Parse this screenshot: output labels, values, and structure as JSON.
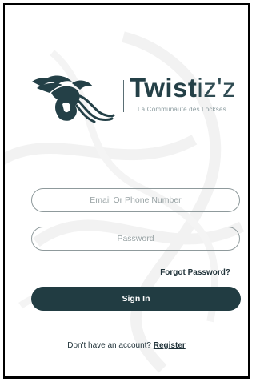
{
  "brand": {
    "name_bold": "Twist",
    "name_light": "iz'z",
    "tagline": "La Communaute des Lockses"
  },
  "form": {
    "email_placeholder": "Email Or Phone Number",
    "password_placeholder": "Password",
    "forgot_label": "Forgot Password?",
    "signin_label": "Sign In"
  },
  "footer": {
    "prompt": "Don't have an account?",
    "register_label": "Register"
  },
  "colors": {
    "accent": "#213c42",
    "brand_text": "#244047",
    "field_border": "#8f9a9c",
    "placeholder": "#9aa4a6"
  },
  "icons": [
    "logo-mark-icon",
    "background-watermark-icon"
  ]
}
